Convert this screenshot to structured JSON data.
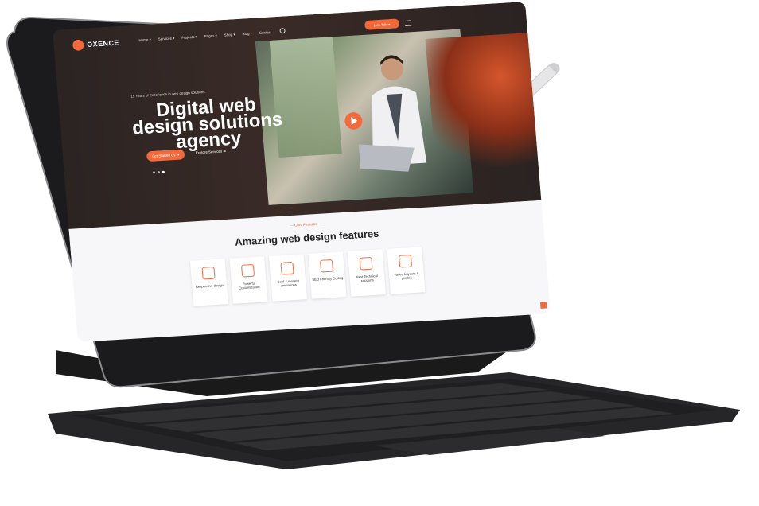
{
  "site": {
    "logo_text": "OXENCE",
    "nav": [
      "Home ▾",
      "Services ▾",
      "Projects ▾",
      "Pages ▾",
      "Shop ▾",
      "Blog ▾",
      "Contact"
    ],
    "cta_label": "Let's Talk ➜"
  },
  "hero": {
    "tagline": "15 Years of Experience in web design solutions",
    "headline": "Digital web design solutions agency",
    "primary_button": "Get Started Us ➜",
    "secondary_button": "Explore Services ➜"
  },
  "features": {
    "kicker": "— Core Features —",
    "title": "Amazing web design features",
    "cards": [
      {
        "label": "Responsive design"
      },
      {
        "label": "Powerful Customization"
      },
      {
        "label": "Cool & modern animations"
      },
      {
        "label": "SEO Friendly Coding"
      },
      {
        "label": "Best Technical supports"
      },
      {
        "label": "Varied Layouts & profiles"
      }
    ]
  },
  "colors": {
    "accent": "#f26a3b",
    "hero_bg": "#2b2422",
    "device_frame": "#1c1c1e",
    "keyboard": "#2a2a2c",
    "pencil": "#e4e4e6"
  }
}
